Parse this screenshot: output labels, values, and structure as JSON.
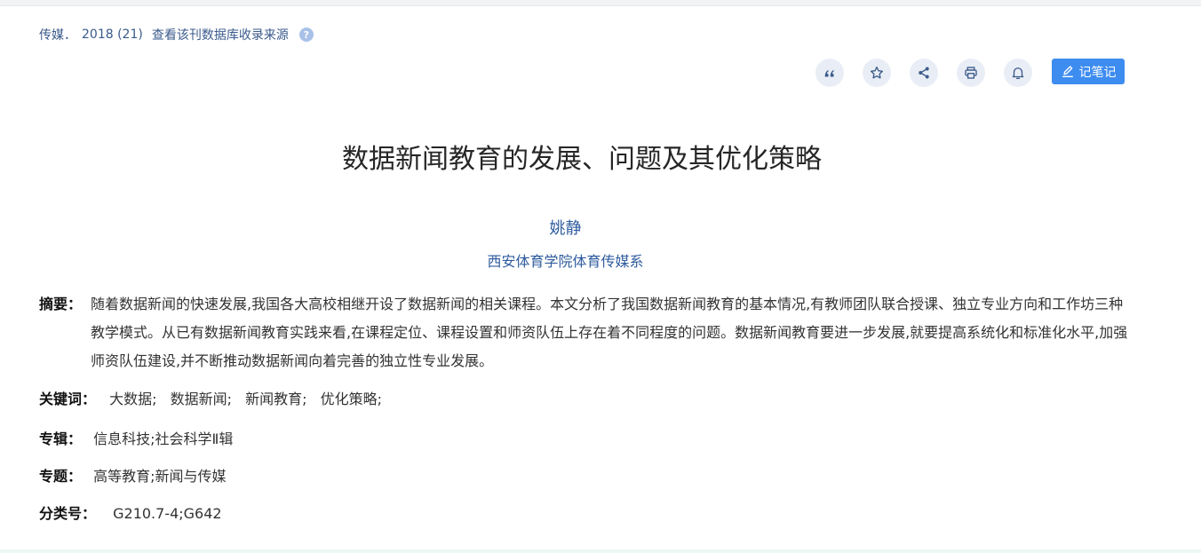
{
  "source": {
    "journal": "传媒．",
    "issue": "2018 (21)",
    "db_link": "查看该刊数据库收录来源",
    "help_symbol": "?"
  },
  "toolbar": {
    "icons": [
      "quote-icon",
      "star-icon",
      "share-icon",
      "print-icon",
      "bell-icon"
    ],
    "note_label": "记笔记",
    "accent_color": "#3d8cf0"
  },
  "article": {
    "title": "数据新闻教育的发展、问题及其优化策略",
    "author": "姚静",
    "affiliation": "西安体育学院体育传媒系"
  },
  "abstract": {
    "label": "摘要：",
    "text": "随着数据新闻的快速发展,我国各大高校相继开设了数据新闻的相关课程。本文分析了我国数据新闻教育的基本情况,有教师团队联合授课、独立专业方向和工作坊三种教学模式。从已有数据新闻教育实践来看,在课程定位、课程设置和师资队伍上存在着不同程度的问题。数据新闻教育要进一步发展,就要提高系统化和标准化水平,加强师资队伍建设,并不断推动数据新闻向着完善的独立性专业发展。"
  },
  "keywords": {
    "label": "关键词：",
    "items": [
      "大数据;",
      "数据新闻;",
      "新闻教育;",
      "优化策略;"
    ]
  },
  "zhuanji": {
    "label": "专辑：",
    "value": "信息科技;社会科学Ⅱ辑"
  },
  "zhuanti": {
    "label": "专题：",
    "value": "高等教育;新闻与传媒"
  },
  "classification": {
    "label": "分类号：",
    "value": "G210.7-4;G642"
  }
}
